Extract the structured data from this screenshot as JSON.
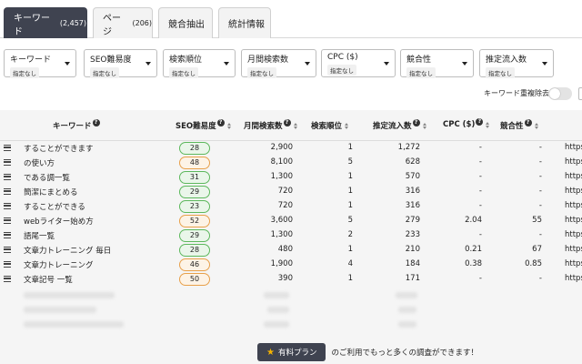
{
  "tabs": [
    {
      "label": "キーワード",
      "count": "(2,457)"
    },
    {
      "label": "ページ",
      "count": "(206)"
    },
    {
      "label": "競合抽出",
      "count": ""
    },
    {
      "label": "統計情報",
      "count": ""
    }
  ],
  "filters": [
    {
      "label": "キーワード",
      "value": "指定なし"
    },
    {
      "label": "SEO難易度",
      "value": "指定なし"
    },
    {
      "label": "検索順位",
      "value": "指定なし"
    },
    {
      "label": "月間検索数",
      "value": "指定なし"
    },
    {
      "label": "CPC ($)",
      "value": "指定なし"
    },
    {
      "label": "競合性",
      "value": "指定なし"
    },
    {
      "label": "推定流入数",
      "value": "指定なし"
    }
  ],
  "dedupe_label": "キーワード重複除去",
  "columns": {
    "keyword": "キーワード",
    "seo": "SEO難易度",
    "volume": "月間検索数",
    "rank": "検索順位",
    "traffic": "推定流入数",
    "cpc": "CPC ($)",
    "competition": "競合性"
  },
  "rows": [
    {
      "keyword": "することができます",
      "seo": "28",
      "volume": "2,900",
      "rank": "1",
      "traffic": "1,272",
      "cpc": "-",
      "competition": "-",
      "url": "https"
    },
    {
      "keyword": "の使い方",
      "seo": "48",
      "volume": "8,100",
      "rank": "5",
      "traffic": "628",
      "cpc": "-",
      "competition": "-",
      "url": "https"
    },
    {
      "keyword": "である調一覧",
      "seo": "31",
      "volume": "1,300",
      "rank": "1",
      "traffic": "570",
      "cpc": "-",
      "competition": "-",
      "url": "https"
    },
    {
      "keyword": "簡潔にまとめる",
      "seo": "29",
      "volume": "720",
      "rank": "1",
      "traffic": "316",
      "cpc": "-",
      "competition": "-",
      "url": "https"
    },
    {
      "keyword": "することができる",
      "seo": "23",
      "volume": "720",
      "rank": "1",
      "traffic": "316",
      "cpc": "-",
      "competition": "-",
      "url": "https"
    },
    {
      "keyword": "webライター始め方",
      "seo": "52",
      "volume": "3,600",
      "rank": "5",
      "traffic": "279",
      "cpc": "2.04",
      "competition": "55",
      "url": "https"
    },
    {
      "keyword": "語尾一覧",
      "seo": "29",
      "volume": "1,300",
      "rank": "2",
      "traffic": "233",
      "cpc": "-",
      "competition": "-",
      "url": "https"
    },
    {
      "keyword": "文章力トレーニング 毎日",
      "seo": "28",
      "volume": "480",
      "rank": "1",
      "traffic": "210",
      "cpc": "0.21",
      "competition": "67",
      "url": "https"
    },
    {
      "keyword": "文章力トレーニング",
      "seo": "46",
      "volume": "1,900",
      "rank": "4",
      "traffic": "184",
      "cpc": "0.38",
      "competition": "0.85",
      "url": "https"
    },
    {
      "keyword": "文章記号 一覧",
      "seo": "50",
      "volume": "390",
      "rank": "1",
      "traffic": "171",
      "cpc": "-",
      "competition": "-",
      "url": "https"
    }
  ],
  "promo": {
    "button": "有料プラン",
    "text": "のご利用でもっと多くの調査ができます！"
  }
}
